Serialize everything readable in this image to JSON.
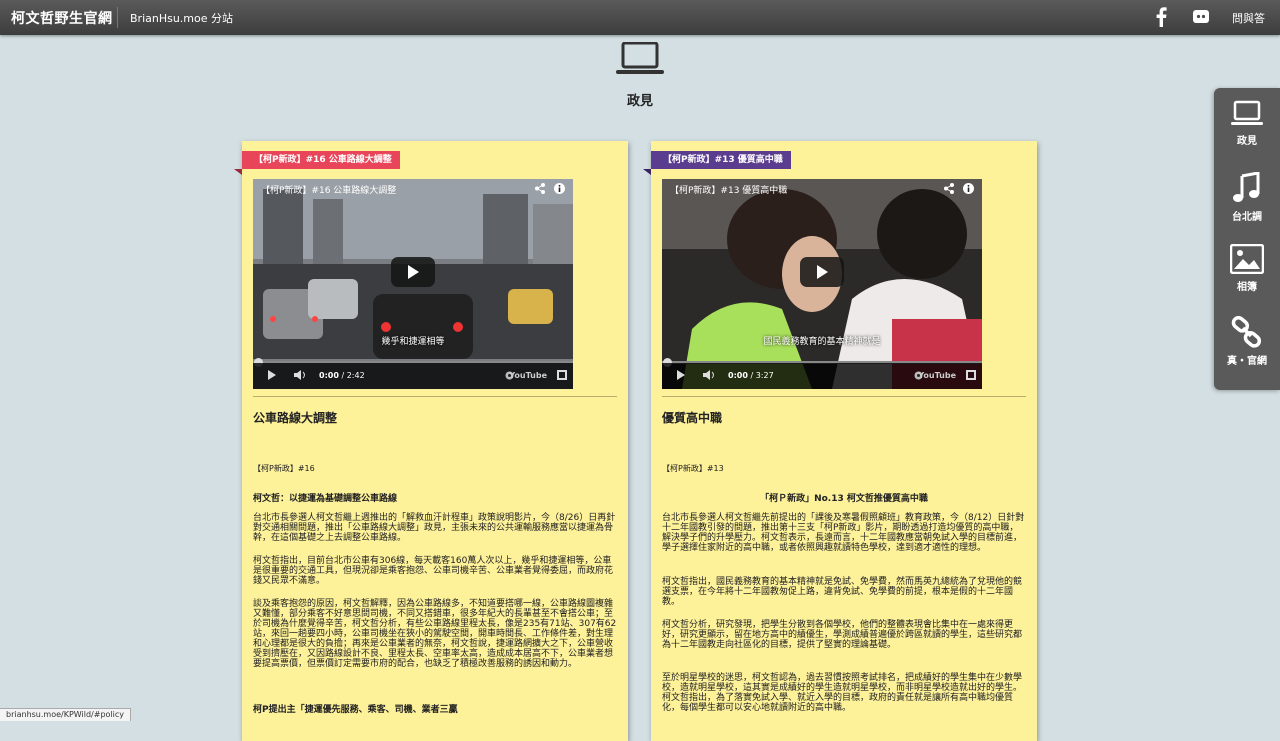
{
  "header": {
    "site_title": "柯文哲野生官網",
    "branch_link": "BrianHsu.moe 分站",
    "facebook_icon": "facebook-icon",
    "chat_icon": "chat-icon",
    "qa_link": "問與答"
  },
  "section": {
    "icon": "laptop-icon",
    "title": "政見"
  },
  "right_nav": [
    {
      "label": "政見",
      "icon": "laptop-icon"
    },
    {
      "label": "台北調",
      "icon": "music-note-icon"
    },
    {
      "label": "相簿",
      "icon": "photo-icon"
    },
    {
      "label": "真・官網",
      "icon": "link-icon"
    }
  ],
  "cards": [
    {
      "ribbon": "【柯P新政】#16 公車路線大調整",
      "video": {
        "title": "【柯P新政】#16 公車路線大調整",
        "subtitle": "幾乎和捷運相等",
        "time_current": "0:00",
        "time_total": "/ 2:42",
        "youtube": "YouTube"
      },
      "title": "公車路線大調整",
      "tag": "【柯P新政】#16",
      "subhead": "柯文哲：以捷運為基礎調整公車路線",
      "paragraphs": [
        "台北市長參選人柯文哲繼上週推出的「解救血汗計程車」政策說明影片，今（8/26）日再針對交通相關問題，推出「公車路線大調整」政見，主張未來的公共運輸服務應當以捷運為骨幹，在這個基礎之上去調整公車路線。",
        "柯文哲指出，目前台北市公車有306線，每天載客160萬人次以上，幾乎和捷運相等，公車是很重要的交通工具，但現況卻是乘客抱怨、公車司機辛苦、公車業者覺得委屈，而政府花錢又民眾不滿意。",
        "談及乘客抱怨的原因，柯文哲解釋，因為公車路線多，不知道要搭哪一線，公車路線圖複雜又難懂，部分乘客不好意思問司機，不同又搭錯車，很多年紀大的長輩甚至不會搭公車；至於司機為什麼覺得辛苦，柯文哲分析，有些公車路線里程太長，像是235有71站、307有62站，來回一趟要四小時，公車司機坐在狹小的駕駛空間，開車時間長、工作條件差，對生理和心理都是很大的負擔；再來是公車業者的無奈，柯文哲說，捷運路網擴大之下，公車營收受到擠壓在，又因路線設計不良、里程太長、空車率太高，造成成本居高不下，公車業者想要提高票價，但票價訂定需要市府的配合，也缺乏了積極改善服務的誘因和動力。",
        "柯P提出主「捷運優先服務、乘客、司機、業者三贏"
      ]
    },
    {
      "ribbon": "【柯P新政】#13 優質高中職",
      "video": {
        "title": "【柯P新政】#13 優質高中職",
        "subtitle": "國民義務教育的基本精神就是",
        "time_current": "0:00",
        "time_total": "/ 3:27",
        "youtube": "YouTube"
      },
      "title": "優質高中職",
      "tag": "【柯P新政】#13",
      "subhead": "「柯Ｐ新政」No.13  柯文哲推優質高中職",
      "paragraphs": [
        "台北市長參選人柯文哲繼先前提出的「課後及寒暑假照顧班」教育政策，今（8/12）日針對十二年國教引發的問題，推出第十三支「柯P新政」影片，期盼透過打造均優質的高中職，解決學子們的升學壓力。柯文哲表示，長遠而言，十二年國教應當朝免試入學的目標前進，學子選擇住家附近的高中職，或者依照興趣就讀特色學校，達到適才適性的理想。",
        "柯文哲指出，國民義務教育的基本精神就是免試、免學費，然而馬英九總統為了兌現他的競選支票，在今年將十二年國教匆促上路，違背免試、免學費的前提，根本是假的十二年國教。",
        "柯文哲分析，研究發現，把學生分散到各個學校，他們的整體表現會比集中在一處來得更好，研究更顯示，留在地方高中的績優生，學測成績普遍優於跨區就讀的學生，這些研究都為十二年國教走向社區化的目標，提供了堅實的理論基礎。",
        "至於明星學校的迷思，柯文哲認為，過去習慣按照考試排名，把成績好的學生集中在少數學校，造就明星學校，這其實是成績好的學生造就明星學校，而非明星學校造就出好的學生。柯文哲指出，為了落實免試入學、就近入學的目標，政府的責任就是讓所有高中職均優質化，每個學生都可以安心地就讀附近的高中職。"
      ]
    }
  ],
  "status_url": "brianhsu.moe/KPWild/#policy",
  "colors": {
    "background": "#d3dfe3",
    "card": "#fdf19a",
    "ribbon_red": "#e8455a",
    "ribbon_purple": "#5b3d8f",
    "topbar": "#4a4a4a"
  }
}
